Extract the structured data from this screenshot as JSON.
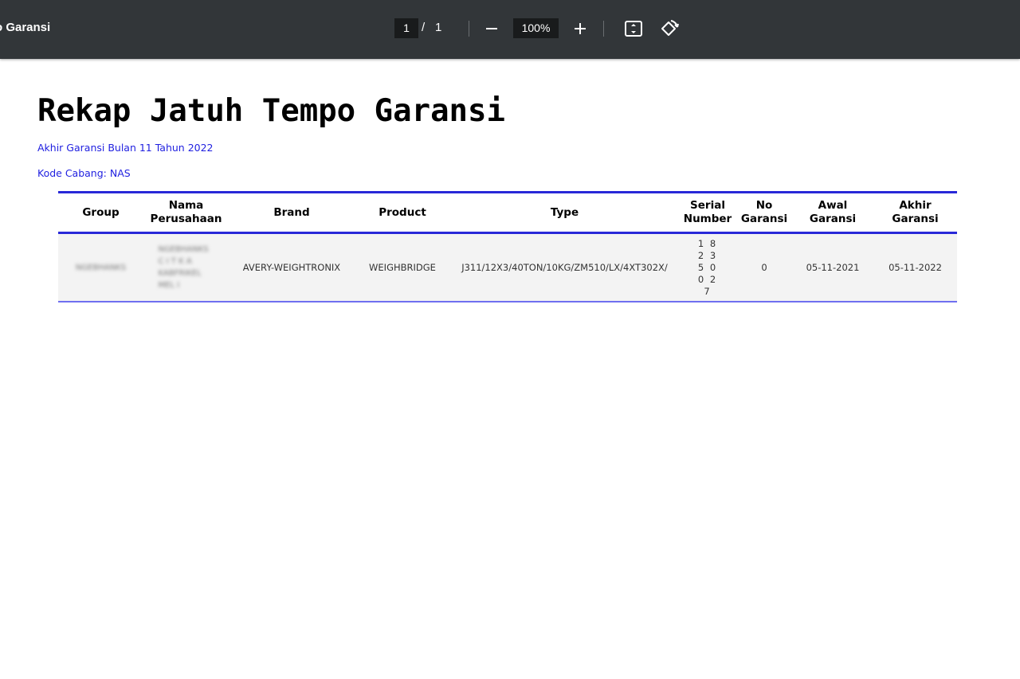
{
  "toolbar": {
    "title": "o Garansi",
    "page_current": "1",
    "page_separator": "/",
    "page_total": "1",
    "zoom": "100%",
    "icons": [
      "minus-icon",
      "plus-icon",
      "fit-page-icon",
      "rotate-icon"
    ]
  },
  "document": {
    "heading": "Rekap Jatuh Tempo Garansi",
    "subtitle": "Akhir Garansi Bulan 11 Tahun 2022",
    "branch": "Kode Cabang: NAS",
    "accent_color": "#2828d8",
    "table": {
      "headers": {
        "group": "Group",
        "nama_perusahaan": "Nama Perusahaan",
        "brand": "Brand",
        "product": "Product",
        "type": "Type",
        "serial_number": "Serial Number",
        "no_garansi": "No Garansi",
        "awal_garansi": "Awal Garansi",
        "akhir_garansi": "Akhir Garansi"
      },
      "rows": [
        {
          "group": "NGEBHANKS",
          "nama_perusahaan": "NGEBHANKS C I T K A KABFRIKEL MEL I",
          "brand": "AVERY-WEIGHTRONIX",
          "product": "WEIGHBRIDGE",
          "type": "J311/12X3/40TON/10KG/ZM510/LX/4XT302X/",
          "serial_number": "1 8 2 3 5 0 0 2 7",
          "no_garansi": "0",
          "awal_garansi": "05-11-2021",
          "akhir_garansi": "05-11-2022"
        }
      ]
    }
  }
}
